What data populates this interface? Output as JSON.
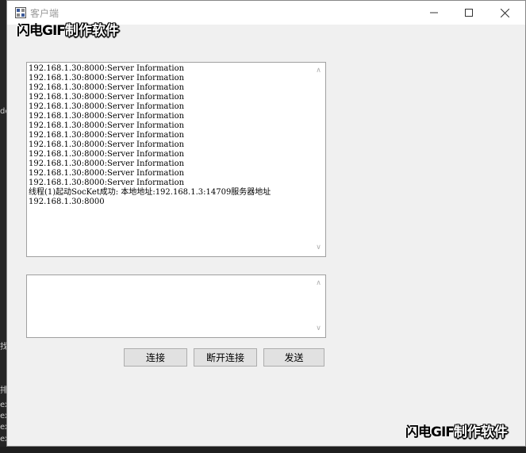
{
  "window": {
    "title": "客户端"
  },
  "watermark": {
    "brand": "闪电GIF",
    "suffix": "制作软件"
  },
  "log": {
    "lines": [
      "192.168.1.30:8000:Server Information",
      "192.168.1.30:8000:Server Information",
      "192.168.1.30:8000:Server Information",
      "192.168.1.30:8000:Server Information",
      "192.168.1.30:8000:Server Information",
      "192.168.1.30:8000:Server Information",
      "192.168.1.30:8000:Server Information",
      "192.168.1.30:8000:Server Information",
      "192.168.1.30:8000:Server Information",
      "192.168.1.30:8000:Server Information",
      "192.168.1.30:8000:Server Information",
      "192.168.1.30:8000:Server Information",
      "192.168.1.30:8000:Server Information",
      "线程(1)起动SocKet成功: 本地地址:192.168.1.3:14709服务器地址",
      "192.168.1.30:8000"
    ]
  },
  "message": {
    "value": ""
  },
  "buttons": {
    "connect": "连接",
    "disconnect": "断开连接",
    "send": "发送"
  },
  "background": {
    "left_fragments": [
      "de",
      "找",
      "排",
      "ex",
      "ex",
      "ex",
      "ex"
    ]
  }
}
